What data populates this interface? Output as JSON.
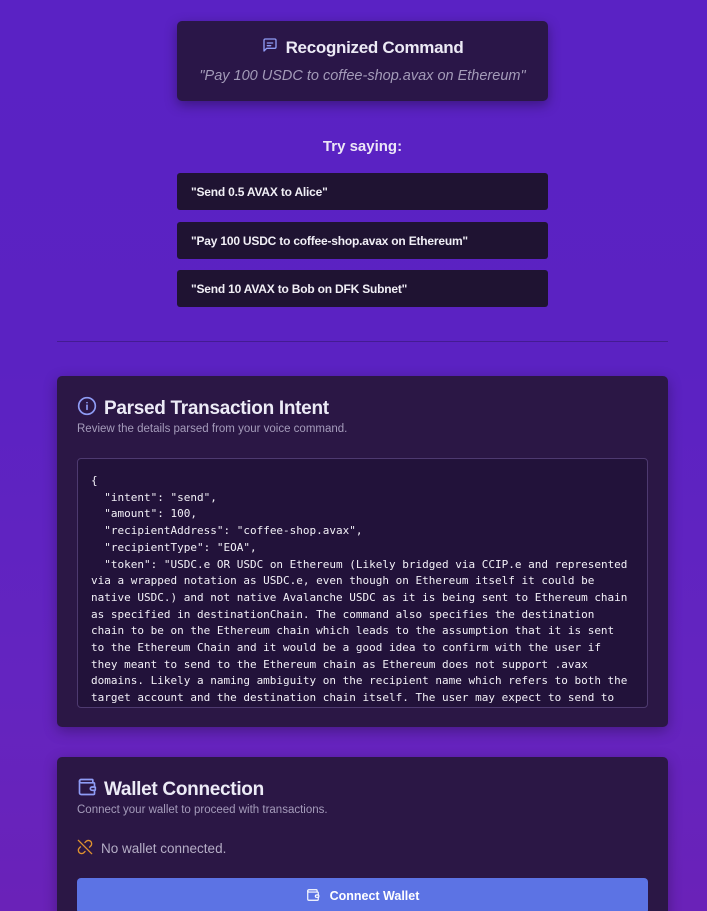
{
  "recognized": {
    "title": "Recognized Command",
    "quote": "\"Pay 100 USDC to coffee-shop.avax on Ethereum\"",
    "icon": "message-square-icon"
  },
  "suggestions": {
    "heading": "Try saying:",
    "items": [
      "\"Send 0.5 AVAX to Alice\"",
      "\"Pay 100 USDC to coffee-shop.avax on Ethereum\"",
      "\"Send 10 AVAX to Bob on DFK Subnet\""
    ]
  },
  "intent": {
    "title": "Parsed Transaction Intent",
    "subtitle": "Review the details parsed from your voice command.",
    "icon": "info-icon",
    "json_text": "{\n  \"intent\": \"send\",\n  \"amount\": 100,\n  \"recipientAddress\": \"coffee-shop.avax\",\n  \"recipientType\": \"EOA\",\n  \"token\": \"USDC.e OR USDC on Ethereum (Likely bridged via CCIP.e and represented via a wrapped notation as USDC.e, even though on Ethereum itself it could be native USDC.) and not native Avalanche USDC as it is being sent to Ethereum chain as specified in destinationChain. The command also specifies the destination chain to be on the Ethereum chain which leads to the assumption that it is sent to the Ethereum Chain and it would be a good idea to confirm with the user if they meant to send to the Ethereum chain as Ethereum does not support .avax domains. Likely a naming ambiguity on the recipient name which refers to both the target account and the destination chain itself. The user may expect to send to coffee-shop.avax's"
  },
  "wallet": {
    "title": "Wallet Connection",
    "subtitle": "Connect your wallet to proceed with transactions.",
    "status": "No wallet connected.",
    "button_label": "Connect Wallet",
    "icon": "wallet-icon",
    "status_icon": "unlink-icon"
  },
  "colors": {
    "accent": "#5c73e4",
    "warning": "#e0922f",
    "panel": "#2b1745"
  }
}
